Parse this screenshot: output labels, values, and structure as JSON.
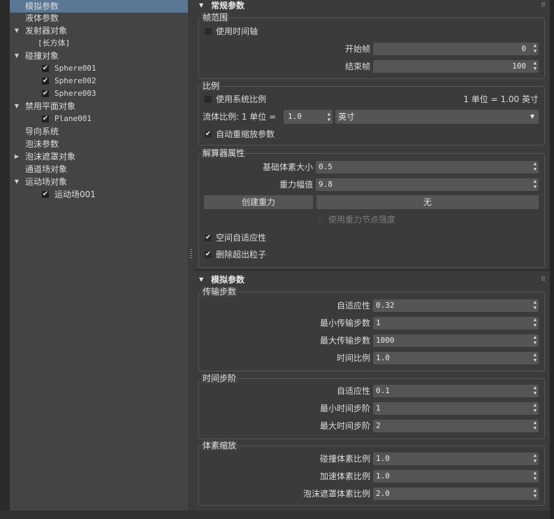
{
  "tree": {
    "items": [
      {
        "label": "模拟参数",
        "selected": true
      },
      {
        "label": "液体参数"
      },
      {
        "label": "发射器对象",
        "expanded": true
      },
      {
        "label": "[长方体]"
      },
      {
        "label": "碰撞对象",
        "expanded": true
      },
      {
        "label": "Sphere001",
        "checked": true
      },
      {
        "label": "Sphere002",
        "checked": true
      },
      {
        "label": "Sphere003",
        "checked": true
      },
      {
        "label": "禁用平面对象",
        "expanded": true
      },
      {
        "label": "Plane001",
        "checked": true
      },
      {
        "label": "导向系统"
      },
      {
        "label": "泡沫参数"
      },
      {
        "label": "泡沫遮罩对象",
        "expanded": false
      },
      {
        "label": "通道场对象"
      },
      {
        "label": "运动场对象",
        "expanded": true
      },
      {
        "label": "运动场001",
        "checked": true
      }
    ]
  },
  "general": {
    "title": "常规参数",
    "frame_range": {
      "title": "帧范围",
      "use_timeline_label": "使用时间轴",
      "start_label": "开始帧",
      "start_value": "0",
      "end_label": "结束帧",
      "end_value": "100"
    },
    "scale": {
      "title": "比例",
      "use_system_scale_label": "使用系统比例",
      "unit_readout": "1 单位 = 1.00 英寸",
      "fluid_scale_label": "流体比例: 1 单位 =",
      "fluid_scale_value": "1.0",
      "unit_option": "英寸",
      "auto_rescale_label": "自动重缩放参数"
    },
    "solver": {
      "title": "解算器属性",
      "voxel_size_label": "基础体素大小",
      "voxel_size_value": "0.5",
      "gravity_label": "重力幅值",
      "gravity_value": "9.8",
      "create_gravity_label": "创建重力",
      "gravity_node_label": "无",
      "use_gravity_node_label": "使用重力节点强度",
      "spatial_adaptivity_label": "空间自适应性",
      "delete_outside_label": "删除超出粒子"
    }
  },
  "simulation": {
    "title": "模拟参数",
    "transport": {
      "title": "传输步数",
      "rows": [
        {
          "label": "自适应性",
          "value": "0.32"
        },
        {
          "label": "最小传输步数",
          "value": "1"
        },
        {
          "label": "最大传输步数",
          "value": "1000"
        },
        {
          "label": "时间比例",
          "value": "1.0"
        }
      ]
    },
    "time_steps": {
      "title": "时间步阶",
      "rows": [
        {
          "label": "自适应性",
          "value": "0.1"
        },
        {
          "label": "最小时间步阶",
          "value": "1"
        },
        {
          "label": "最大时间步阶",
          "value": "2"
        }
      ]
    },
    "voxel_scale": {
      "title": "体素缩放",
      "rows": [
        {
          "label": "碰撞体素比例",
          "value": "1.0"
        },
        {
          "label": "加速体素比例",
          "value": "1.0"
        },
        {
          "label": "泡沫遮罩体素比例",
          "value": "2.0"
        }
      ]
    }
  }
}
